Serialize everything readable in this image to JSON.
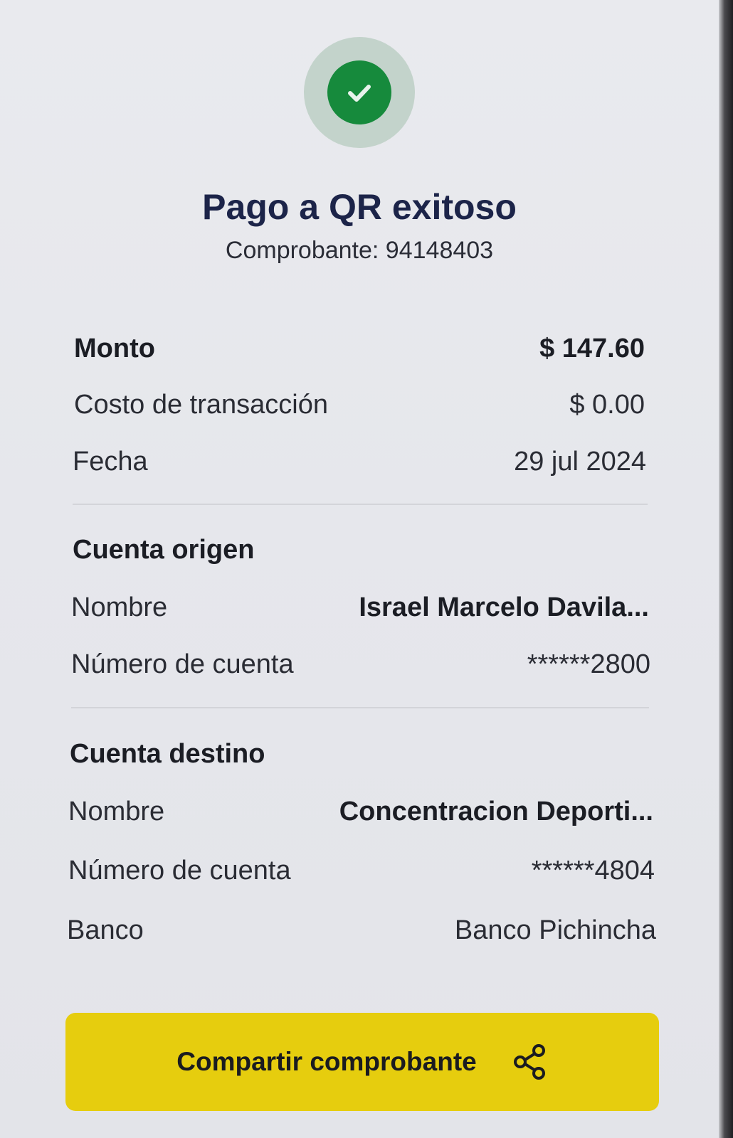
{
  "status": {
    "icon": "check-icon",
    "title": "Pago a QR exitoso",
    "receipt_label": "Comprobante: 94148403"
  },
  "summary": {
    "amount_label": "Monto",
    "amount_value": "$ 147.60",
    "fee_label": "Costo de transacción",
    "fee_value": "$ 0.00",
    "date_label": "Fecha",
    "date_value": "29 jul 2024"
  },
  "origin": {
    "heading": "Cuenta origen",
    "name_label": "Nombre",
    "name_value": "Israel Marcelo Davila...",
    "account_label": "Número de cuenta",
    "account_value": "******2800"
  },
  "destination": {
    "heading": "Cuenta destino",
    "name_label": "Nombre",
    "name_value": "Concentracion Deporti...",
    "account_label": "Número de cuenta",
    "account_value": "******4804",
    "bank_label": "Banco",
    "bank_value": "Banco Pichincha"
  },
  "actions": {
    "share_label": "Compartir comprobante",
    "share_icon": "share-icon"
  },
  "colors": {
    "success": "#168a3c",
    "success_halo": "#c3d3cb",
    "title": "#1c2449",
    "button": "#e6cd0e"
  }
}
